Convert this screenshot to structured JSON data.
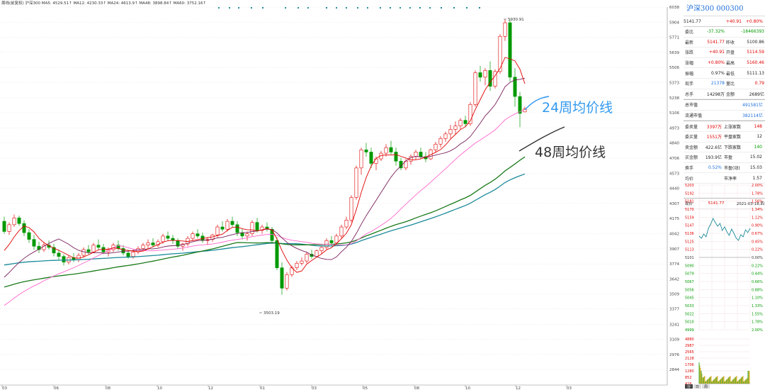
{
  "chart_data": {
    "type": "candlestick",
    "ma_legend": "周线(前复权)  沪深300  MA5: 4529.51↑  MA12: 4230.33↑  MA24: 4613.9↑  MA48: 3898.84↑  MA60: 3752.16↑",
    "y_ticks": [
      "6038",
      "5904",
      "5771",
      "5639",
      "5506",
      "5373",
      "5238",
      "5106",
      "4973",
      "4840",
      "4706",
      "4573",
      "4440",
      "4307",
      "4175",
      "4042",
      "3907",
      "3774",
      "3642",
      "3509",
      "3377",
      "3241",
      "3109",
      "2976",
      "2844"
    ],
    "x_ticks": [
      "03",
      "06",
      "08",
      "10",
      "12",
      "01",
      "03",
      "05",
      "08",
      "10",
      "12",
      "03"
    ],
    "high_label": "5930.91",
    "low_label": "3503.19",
    "annotations": [
      {
        "text": "24周均价线"
      },
      {
        "text": "48周均价线"
      }
    ],
    "colors": {
      "up": "#e00000",
      "down": "#009900",
      "ma5": "#e00000",
      "ma12": "#7a1f5c",
      "ma24": "#ff66cc",
      "ma48": "#1a7a1a",
      "ma60": "#1b8a9a"
    }
  },
  "quote_panel": {
    "title": "沪深300 000300",
    "price": "5141.77",
    "change": "+40.91",
    "change_pct": "+0.80%",
    "rows": [
      {
        "l1": "委比",
        "v1": "-37.32%",
        "l2": "",
        "v2": "-18466393"
      },
      {
        "l1": "最新",
        "v1": "5141.77",
        "l2": "昨收",
        "v2": "5100.86"
      },
      {
        "l1": "涨跌",
        "v1": "+40.91",
        "l2": "开盘",
        "v2": "5114.59"
      },
      {
        "l1": "涨幅",
        "v1": "+0.80%",
        "l2": "最高",
        "v2": "5160.46"
      },
      {
        "l1": "振幅",
        "v1": "0.97%",
        "l2": "最低",
        "v2": "5111.13"
      },
      {
        "l1": "现手",
        "v1": "21378",
        "l2": "量比",
        "v2": "0.79"
      },
      {
        "l1": "总手",
        "v1": "14298万",
        "l2": "金额",
        "v2": "2689亿"
      }
    ],
    "cap_rows": [
      {
        "l": "总市值",
        "v": "491581亿"
      },
      {
        "l": "流通市值",
        "v": "382114亿"
      }
    ],
    "stat_rows": [
      {
        "l1": "委卖量",
        "v1": "3397万",
        "l2": "上涨家数",
        "v2": "148"
      },
      {
        "l1": "委买量",
        "v1": "1551万",
        "l2": "平盘家数",
        "v2": "12"
      },
      {
        "l1": "卖金额",
        "v1": "422.6亿",
        "l2": "下跌家数",
        "v2": "140"
      },
      {
        "l1": "买金额",
        "v1": "193.9亿",
        "l2": "市盈",
        "v2": "15.02"
      },
      {
        "l1": "换手",
        "v1": "0.52%",
        "l2": "市盈(动)",
        "v2": "15.03"
      },
      {
        "l1": "均价",
        "v1": "",
        "l2": "市净率",
        "v2": "1.57"
      }
    ],
    "mini_header_left": "现价",
    "mini_header_price": "5141.77",
    "mini_header_date": "2021-03-18,四",
    "mini_left_ticks": [
      "5203",
      "5192",
      "5181",
      "5170",
      "5159",
      "5147",
      "5136",
      "5125",
      "5113",
      "5101",
      "5090",
      "5079",
      "5067",
      "5056",
      "5045",
      "5033",
      "5022",
      "5010",
      "4999"
    ],
    "mini_right_ticks": [
      "2.00%",
      "1.78%",
      "1.56%",
      "1.34%",
      "1.12%",
      "0.90%",
      "0.67%",
      "0.45%",
      "0.22%",
      "0.00%",
      "0.22%",
      "0.44%",
      "0.66%",
      "0.88%",
      "1.10%",
      "1.33%",
      "1.55%",
      "1.78%",
      "2.00%"
    ],
    "vol_ticks": [
      "4880",
      "2987",
      "2565",
      "2128",
      "1706",
      "1280",
      "852",
      "426"
    ],
    "bottom_tabs": [
      "分",
      "日",
      "周"
    ]
  }
}
